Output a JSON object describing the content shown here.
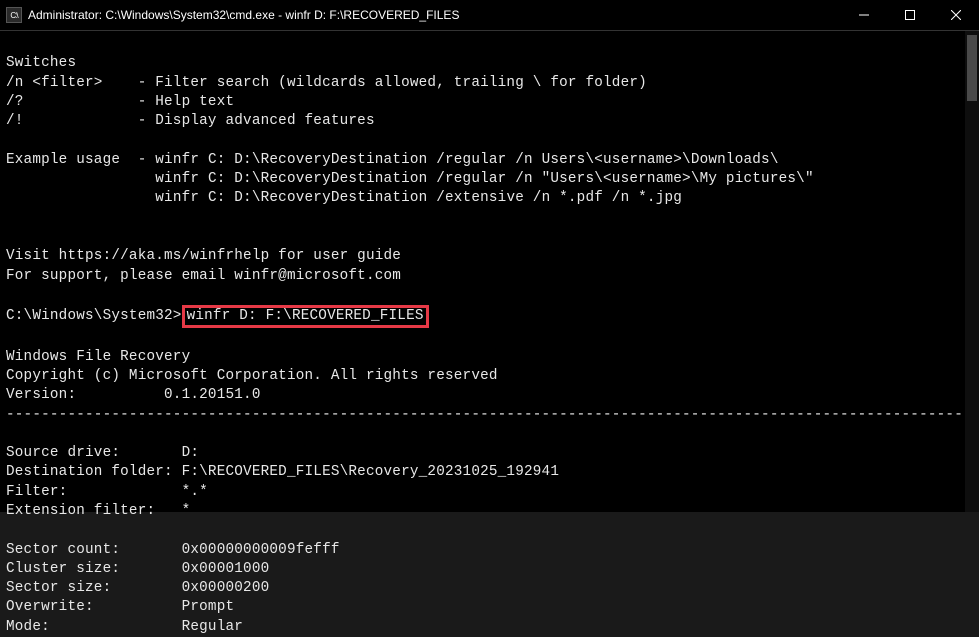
{
  "titlebar": {
    "icon_label": "cmd-icon",
    "text": "Administrator: C:\\Windows\\System32\\cmd.exe - winfr  D: F:\\RECOVERED_FILES"
  },
  "window_controls": {
    "minimize": "—",
    "maximize": "▢",
    "close": "✕"
  },
  "terminal": {
    "switches_header": "Switches",
    "sw_n": "/n <filter>    - Filter search (wildcards allowed, trailing \\ for folder)",
    "sw_q": "/?             - Help text",
    "sw_ex": "/!             - Display advanced features",
    "example_label": "Example usage  -",
    "ex1": "winfr C: D:\\RecoveryDestination /regular /n Users\\<username>\\Downloads\\",
    "ex2": "winfr C: D:\\RecoveryDestination /regular /n \"Users\\<username>\\My pictures\\\"",
    "ex3": "winfr C: D:\\RecoveryDestination /extensive /n *.pdf /n *.jpg",
    "help1": "Visit https://aka.ms/winfrhelp for user guide",
    "help2": "For support, please email winfr@microsoft.com",
    "prompt_path": "C:\\Windows\\System32>",
    "prompt_cmd": "winfr D: F:\\RECOVERED_FILES",
    "app_name": "Windows File Recovery",
    "copyright": "Copyright (c) Microsoft Corporation. All rights reserved",
    "version_line": "Version:          0.1.20151.0",
    "divider": "----------------------------------------------------------------------------------------------------------------------",
    "info": {
      "source": "Source drive:       D:",
      "dest": "Destination folder: F:\\RECOVERED_FILES\\Recovery_20231025_192941",
      "filter": "Filter:             *.*",
      "extfil": "Extension filter:   *",
      "sector": "Sector count:       0x00000000009fefff",
      "cluster": "Cluster size:       0x00001000",
      "secsize": "Sector size:        0x00000200",
      "overwrite": "Overwrite:          Prompt",
      "mode": "Mode:               Regular"
    }
  }
}
